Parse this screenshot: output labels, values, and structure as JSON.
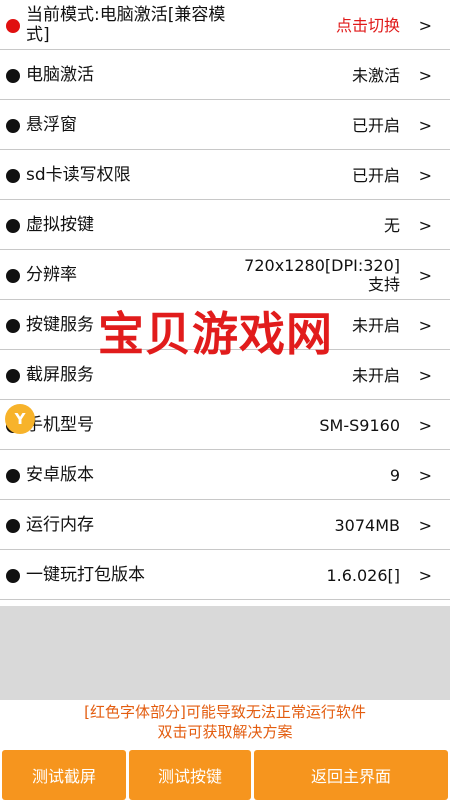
{
  "rows": [
    {
      "label": "当前模式:电脑激活[兼容模式]",
      "value": "点击切换",
      "chevron": ">"
    },
    {
      "label": "电脑激活",
      "value": "未激活",
      "chevron": ">"
    },
    {
      "label": "悬浮窗",
      "value": "已开启",
      "chevron": ">"
    },
    {
      "label": "sd卡读写权限",
      "value": "已开启",
      "chevron": ">"
    },
    {
      "label": "虚拟按键",
      "value": "无",
      "chevron": ">"
    },
    {
      "label": "分辨率",
      "value_line1": "720x1280[DPI:320]",
      "value_line2": "支持",
      "chevron": ">"
    },
    {
      "label": "按键服务",
      "value": "未开启",
      "chevron": ">"
    },
    {
      "label": "截屏服务",
      "value": "未开启",
      "chevron": ">"
    },
    {
      "label": "手机型号",
      "value": "SM-S9160",
      "chevron": ">"
    },
    {
      "label": "安卓版本",
      "value": "9",
      "chevron": ">"
    },
    {
      "label": "运行内存",
      "value": "3074MB",
      "chevron": ">"
    },
    {
      "label": "一键玩打包版本",
      "value": "1.6.026[]",
      "chevron": ">"
    }
  ],
  "warning": {
    "line1": "[红色字体部分]可能导致无法正常运行软件",
    "line2": "双击可获取解决方案"
  },
  "buttons": {
    "test_screenshot": "测试截屏",
    "test_keys": "测试按键",
    "back_home": "返回主界面"
  },
  "watermark": {
    "text": "宝贝游戏网",
    "icon_letter": "Y"
  },
  "colors": {
    "accent_orange": "#f6951e",
    "warning_red": "#e01a1a",
    "warning_text": "#e35d10"
  }
}
